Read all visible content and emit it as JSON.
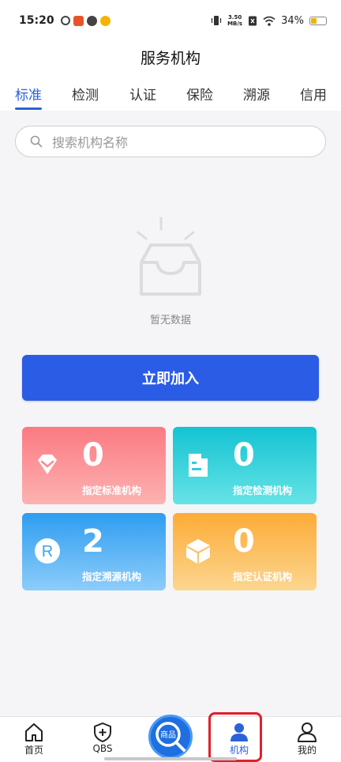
{
  "status_bar": {
    "time": "15:20",
    "net_speed_value": "3.50",
    "net_speed_unit": "MB/s",
    "battery": "34%",
    "battery_level": 0.34
  },
  "header": {
    "title": "服务机构"
  },
  "tabs": [
    {
      "label": "标准",
      "active": true
    },
    {
      "label": "检测",
      "active": false
    },
    {
      "label": "认证",
      "active": false
    },
    {
      "label": "保险",
      "active": false
    },
    {
      "label": "溯源",
      "active": false
    },
    {
      "label": "信用",
      "active": false
    }
  ],
  "search": {
    "placeholder": "搜索机构名称",
    "icon": "search-icon"
  },
  "empty_state": {
    "text": "暂无数据",
    "icon": "empty-inbox-icon"
  },
  "join_button": {
    "label": "立即加入",
    "color": "#2b5ce6"
  },
  "stats": [
    {
      "count": "0",
      "label": "指定标准机构",
      "icon": "diamond-icon"
    },
    {
      "count": "0",
      "label": "指定检测机构",
      "icon": "document-icon"
    },
    {
      "count": "2",
      "label": "指定溯源机构",
      "icon": "registered-icon"
    },
    {
      "count": "0",
      "label": "指定认证机构",
      "icon": "cube-icon"
    }
  ],
  "bottom_nav": [
    {
      "label": "首页",
      "icon": "home-icon"
    },
    {
      "label": "QBS",
      "icon": "shield-plus-icon"
    },
    {
      "label": "商品",
      "icon": "search-icon"
    },
    {
      "label": "机构",
      "icon": "person-icon",
      "active": true
    },
    {
      "label": "我的",
      "icon": "user-icon"
    }
  ],
  "colors": {
    "accent": "#2b62d8",
    "highlight": "#e0202a"
  }
}
